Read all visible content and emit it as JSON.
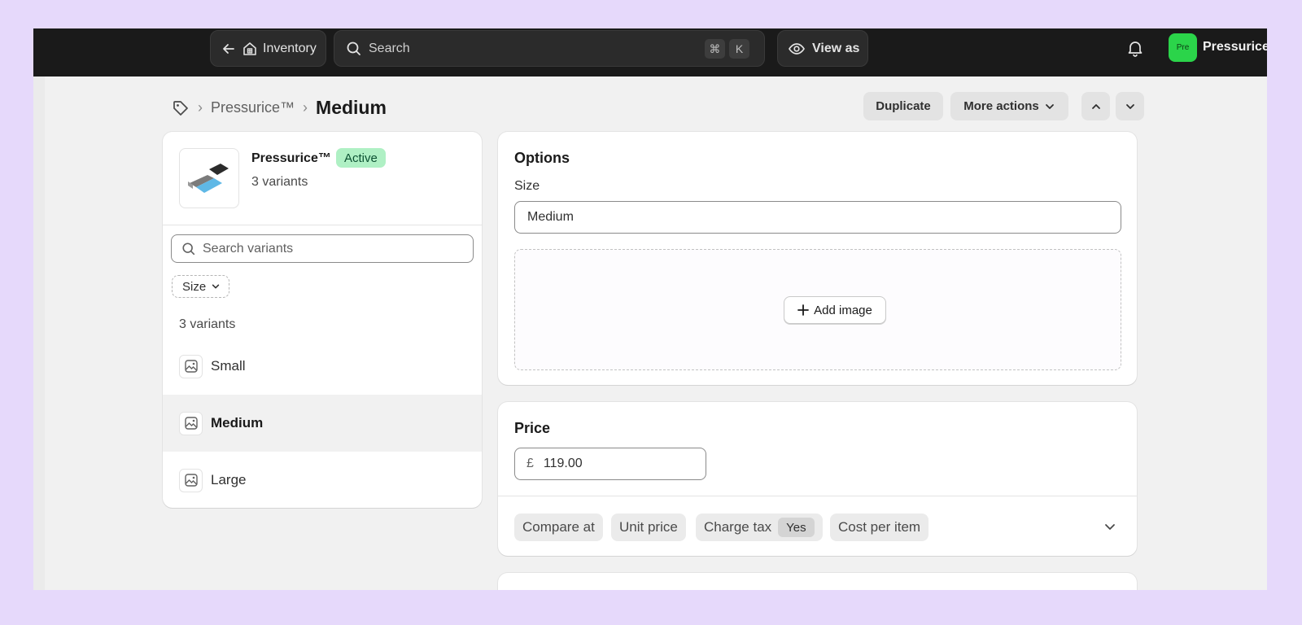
{
  "topbar": {
    "back_label": "Inventory",
    "search_placeholder": "Search",
    "shortcut_cmd": "⌘",
    "shortcut_key": "K",
    "view_as_label": "View as",
    "store_avatar_text": "Pre",
    "store_name": "Pressurice"
  },
  "breadcrumb": {
    "parent": "Pressurice™",
    "current": "Medium"
  },
  "header_actions": {
    "duplicate_label": "Duplicate",
    "more_actions_label": "More actions"
  },
  "product": {
    "name": "Pressurice™",
    "status": "Active",
    "variant_count": "3 variants"
  },
  "variants_panel": {
    "search_placeholder": "Search variants",
    "filter_label": "Size",
    "count_label": "3 variants",
    "items": [
      {
        "label": "Small",
        "selected": false
      },
      {
        "label": "Medium",
        "selected": true
      },
      {
        "label": "Large",
        "selected": false
      }
    ]
  },
  "options_card": {
    "title": "Options",
    "size_label": "Size",
    "size_value": "Medium",
    "add_image_label": "Add image"
  },
  "price_card": {
    "title": "Price",
    "currency_symbol": "£",
    "price_value": "119.00",
    "compare_at_label": "Compare at",
    "unit_price_label": "Unit price",
    "charge_tax_label": "Charge tax",
    "charge_tax_value": "Yes",
    "cost_per_item_label": "Cost per item"
  },
  "colors": {
    "topbar_bg": "#1a1a1a",
    "page_bg": "#f1f1f1",
    "active_badge_bg": "#aff0c4",
    "active_badge_text": "#0c5132",
    "store_avatar_bg": "#2bd44a",
    "outer_bg": "#e6d9fb"
  }
}
